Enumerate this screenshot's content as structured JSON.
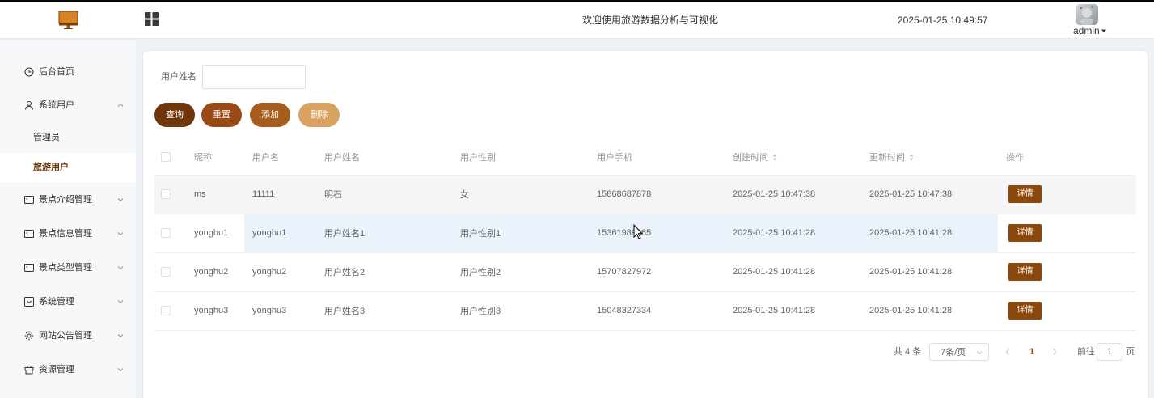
{
  "header": {
    "title": "欢迎使用旅游数据分析与可视化",
    "datetime": "2025-01-25 10:49:57",
    "username": "admin",
    "logo_icon": "monitor-icon",
    "menu_toggle_icon": "grid-icon"
  },
  "sidebar": {
    "items": [
      {
        "label": "后台首页",
        "icon": "clock-icon"
      },
      {
        "label": "系统用户",
        "icon": "user-icon",
        "expanded": true,
        "children": [
          {
            "label": "管理员"
          },
          {
            "label": "旅游用户",
            "active": true
          }
        ]
      },
      {
        "label": "景点介绍管理",
        "icon": "picture-icon",
        "expanded": false
      },
      {
        "label": "景点信息管理",
        "icon": "picture-icon",
        "expanded": false
      },
      {
        "label": "景点类型管理",
        "icon": "picture-icon",
        "expanded": false
      },
      {
        "label": "系统管理",
        "icon": "inbox-icon",
        "expanded": false
      },
      {
        "label": "网站公告管理",
        "icon": "sun-icon",
        "expanded": false
      },
      {
        "label": "资源管理",
        "icon": "box-icon",
        "expanded": false
      }
    ]
  },
  "search": {
    "label": "用户姓名",
    "value": ""
  },
  "buttons": {
    "query": {
      "label": "查询"
    },
    "reset": {
      "label": "重置"
    },
    "add": {
      "label": "添加"
    },
    "delete": {
      "label": "删除",
      "disabled": true
    }
  },
  "table": {
    "columns": [
      {
        "label": "昵称"
      },
      {
        "label": "用户名"
      },
      {
        "label": "用户姓名"
      },
      {
        "label": "用户性别"
      },
      {
        "label": "用户手机"
      },
      {
        "label": "创建时间",
        "sortable": true
      },
      {
        "label": "更新时间",
        "sortable": true
      },
      {
        "label": "操作"
      }
    ],
    "rows": [
      {
        "nickname": "ms",
        "username": "11111",
        "real_name": "明石",
        "gender": "女",
        "phone": "15868687878",
        "created": "2025-01-25 10:47:38",
        "updated": "2025-01-25 10:47:38",
        "action": "详情"
      },
      {
        "nickname": "yonghu1",
        "username": "yonghu1",
        "real_name": "用户姓名1",
        "gender": "用户性别1",
        "phone": "15361989365",
        "created": "2025-01-25 10:41:28",
        "updated": "2025-01-25 10:41:28",
        "action": "详情"
      },
      {
        "nickname": "yonghu2",
        "username": "yonghu2",
        "real_name": "用户姓名2",
        "gender": "用户性别2",
        "phone": "15707827972",
        "created": "2025-01-25 10:41:28",
        "updated": "2025-01-25 10:41:28",
        "action": "详情"
      },
      {
        "nickname": "yonghu3",
        "username": "yonghu3",
        "real_name": "用户姓名3",
        "gender": "用户性别3",
        "phone": "15048327334",
        "created": "2025-01-25 10:41:28",
        "updated": "2025-01-25 10:41:28",
        "action": "详情"
      }
    ]
  },
  "pagination": {
    "total_text": "共 4 条",
    "page_size": "7条/页",
    "current_page": "1",
    "goto_label": "前往",
    "goto_value": "1",
    "page_suffix": "页"
  },
  "colors": {
    "query_button": "#6e360a",
    "reset_button": "#9a4a14",
    "add_button": "#a65c1d",
    "delete_button": "#d9a262",
    "detail_button": "#8b4a0c",
    "active_menu_text": "#6e3a0c",
    "current_page": "#8b4a0c"
  }
}
